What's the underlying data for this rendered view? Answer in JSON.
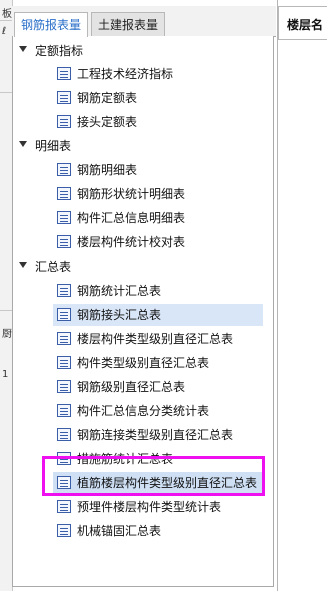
{
  "left_sliver": {
    "marks": [
      "板",
      "ℓ",
      "厨",
      "1"
    ]
  },
  "tabs": [
    {
      "label": "钢筋报表量",
      "active": true
    },
    {
      "label": "土建报表量",
      "active": false
    }
  ],
  "tree": {
    "groups": [
      {
        "label": "定额指标",
        "items": [
          {
            "label": "工程技术经济指标"
          },
          {
            "label": "钢筋定额表"
          },
          {
            "label": "接头定额表"
          }
        ]
      },
      {
        "label": "明细表",
        "items": [
          {
            "label": "钢筋明细表"
          },
          {
            "label": "钢筋形状统计明细表"
          },
          {
            "label": "构件汇总信息明细表"
          },
          {
            "label": "楼层构件统计校对表"
          }
        ]
      },
      {
        "label": "汇总表",
        "items": [
          {
            "label": "钢筋统计汇总表"
          },
          {
            "label": "钢筋接头汇总表"
          },
          {
            "label": "楼层构件类型级别直径汇总表"
          },
          {
            "label": "构件类型级别直径汇总表"
          },
          {
            "label": "钢筋级别直径汇总表"
          },
          {
            "label": "构件汇总信息分类统计表"
          },
          {
            "label": "钢筋连接类型级别直径汇总表"
          },
          {
            "label": "措施筋统计汇总表"
          },
          {
            "label": "植筋楼层构件类型级别直径汇总表"
          },
          {
            "label": "预埋件楼层构件类型统计表"
          },
          {
            "label": "机械锚固汇总表"
          }
        ]
      }
    ]
  },
  "right_panel": {
    "header": "楼层名"
  }
}
